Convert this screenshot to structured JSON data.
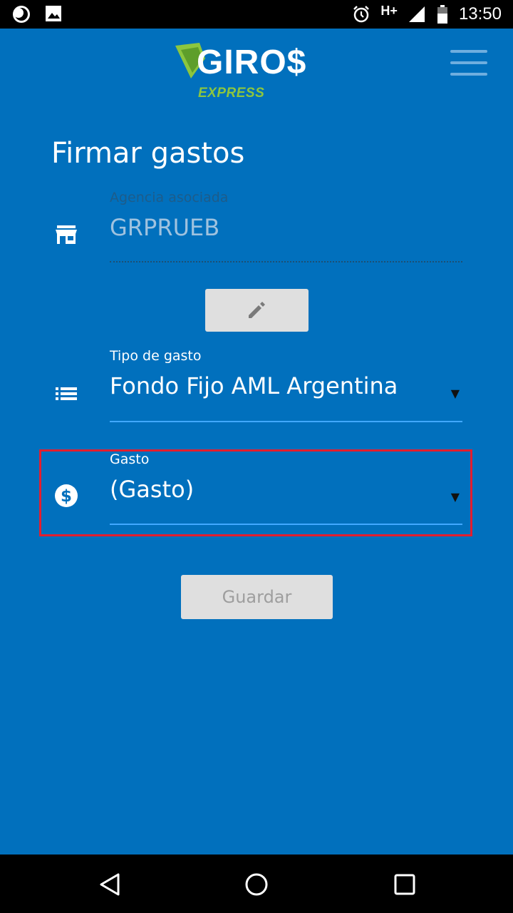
{
  "status_bar": {
    "time": "13:50",
    "network": "H+",
    "icons": [
      "moon-icon",
      "image-icon",
      "alarm-icon",
      "signal-icon",
      "battery-icon"
    ]
  },
  "header": {
    "logo_text": "GIRO$",
    "logo_subtitle": "EXPRESS",
    "menu_icon": "hamburger-menu-icon"
  },
  "page": {
    "title": "Firmar gastos"
  },
  "form": {
    "agency": {
      "label": "Agencia asociada",
      "value": "GRPRUEB",
      "icon": "store-icon"
    },
    "edit_icon": "pencil-icon",
    "expense_type": {
      "label": "Tipo de gasto",
      "value": "Fondo Fijo AML Argentina",
      "icon": "list-icon"
    },
    "expense": {
      "label": "Gasto",
      "value": "(Gasto)",
      "icon": "dollar-circle-icon"
    },
    "save_label": "Guardar"
  },
  "colors": {
    "background": "#0170bd",
    "accent_green": "#8cc63f",
    "highlight_red": "#e31e2e",
    "underline_active": "#41a8ff"
  },
  "nav_bar": {
    "buttons": [
      "back-icon",
      "home-icon",
      "recents-icon"
    ]
  }
}
